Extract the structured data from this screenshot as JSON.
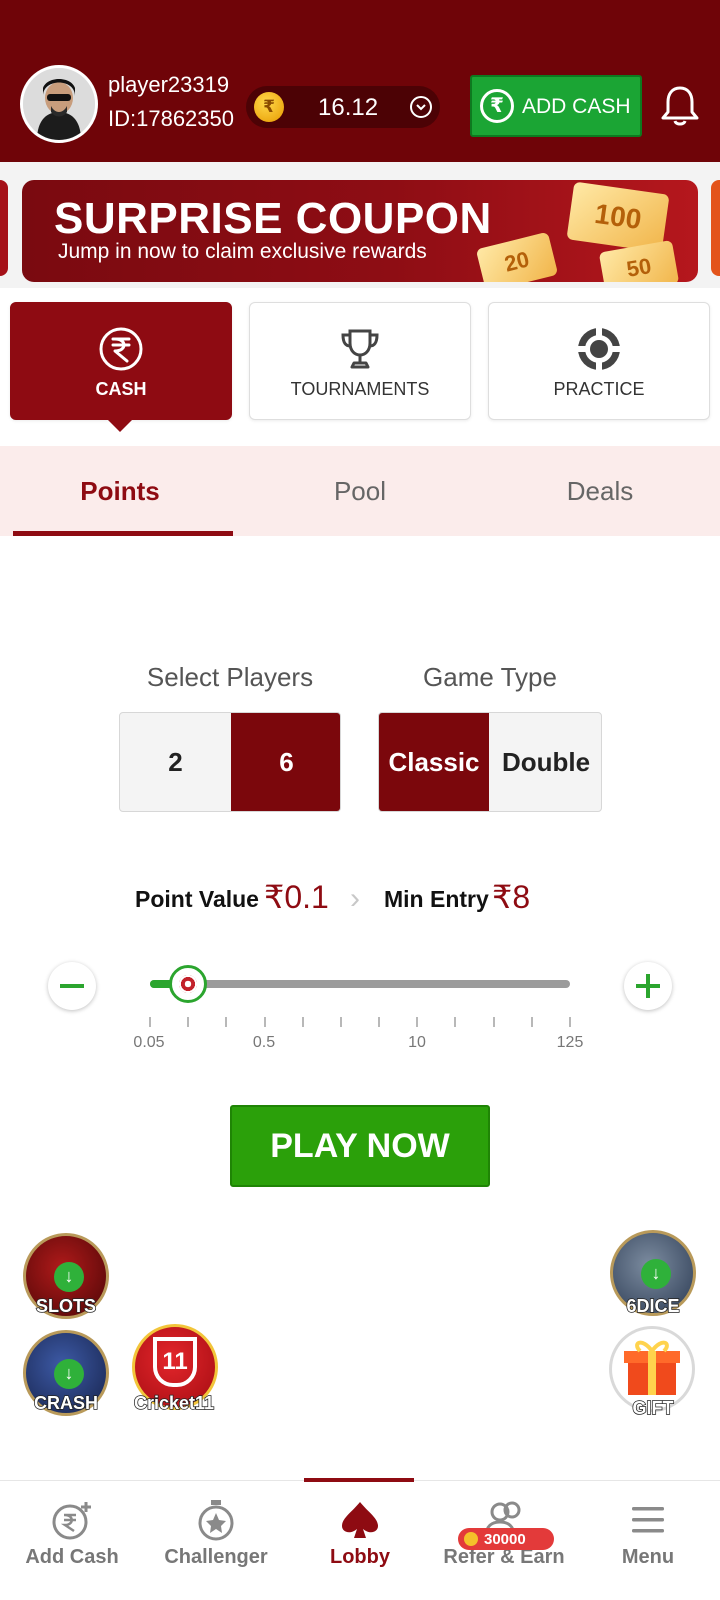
{
  "header": {
    "username": "player23319",
    "user_id": "ID:17862350",
    "balance": "16.12",
    "coin_symbol": "₹",
    "add_cash_label": "ADD CASH",
    "add_cash_symbol": "₹"
  },
  "banner": {
    "title": "SURPRISE COUPON",
    "subtitle": "Jump in now to claim exclusive rewards",
    "coupon_values": [
      "100",
      "20",
      "50"
    ]
  },
  "modes": [
    {
      "label": "CASH",
      "icon": "rupee-circle-icon",
      "active": true
    },
    {
      "label": "TOURNAMENTS",
      "icon": "trophy-icon",
      "active": false
    },
    {
      "label": "PRACTICE",
      "icon": "poker-chip-icon",
      "active": false
    }
  ],
  "tabs": [
    {
      "label": "Points",
      "active": true
    },
    {
      "label": "Pool",
      "active": false
    },
    {
      "label": "Deals",
      "active": false
    }
  ],
  "select_players": {
    "title": "Select Players",
    "options": [
      "2",
      "6"
    ],
    "selected": "6"
  },
  "game_type": {
    "title": "Game Type",
    "options": [
      "Classic",
      "Double"
    ],
    "selected": "Classic"
  },
  "point_value": {
    "label": "Point Value",
    "value": "₹0.1",
    "min_entry_label": "Min Entry",
    "min_entry_value": "₹8"
  },
  "slider": {
    "tick_labels": [
      "0.05",
      "0.5",
      "10",
      "125"
    ],
    "tick_count": 12,
    "selected_step_index": 1
  },
  "play_now_label": "PLAY NOW",
  "floating_games": {
    "slots": "SLOTS",
    "crash": "CRASH",
    "cricket": "Cricket11",
    "dice": "6DICE",
    "gift": "GIFT",
    "cricket_badge": "11"
  },
  "bottom_nav": [
    {
      "label": "Add Cash",
      "icon": "rupee-plus-icon",
      "active": false
    },
    {
      "label": "Challenger",
      "icon": "stopwatch-icon",
      "active": false
    },
    {
      "label": "Lobby",
      "icon": "spade-icon",
      "active": true
    },
    {
      "label": "Refer & Earn",
      "icon": "users-icon",
      "active": false,
      "badge": "30000"
    },
    {
      "label": "Menu",
      "icon": "hamburger-icon",
      "active": false
    }
  ],
  "colors": {
    "header_bg": "#6f0408",
    "accent": "#8e0b12",
    "green": "#2ba00a"
  }
}
